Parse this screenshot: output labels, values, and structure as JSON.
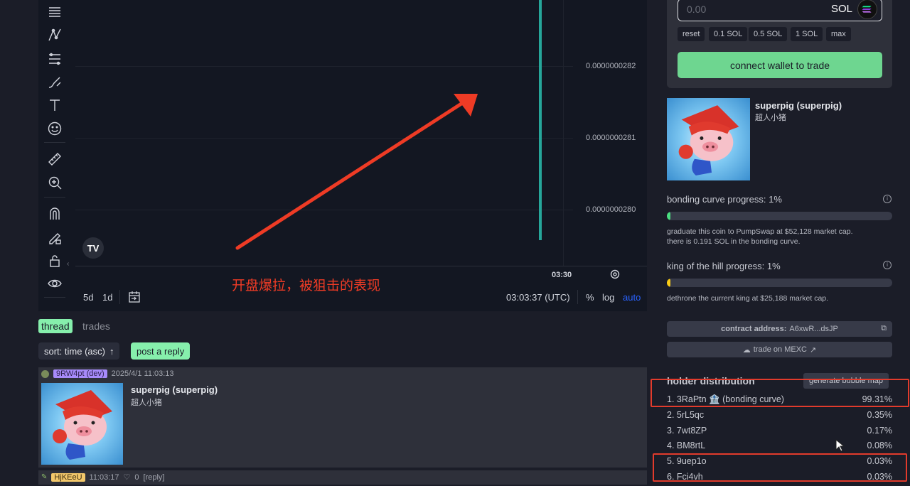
{
  "toolbar": {
    "tools": [
      "menu-lines-icon",
      "trend-line-icon",
      "fib-icon",
      "brush-icon",
      "text-icon",
      "emoji-icon",
      "ruler-icon",
      "zoom-in-icon",
      "magnet-icon",
      "lock-pencil-icon",
      "unlock-icon",
      "eye-icon"
    ]
  },
  "chart": {
    "price_labels": [
      "0.0000000282",
      "0.0000000281",
      "0.0000000280"
    ],
    "time_label": "03:30",
    "annotation": "开盘爆拉，被狙击的表现",
    "logo": "TV",
    "bottom": {
      "range_5d": "5d",
      "range_1d": "1d",
      "clock": "03:03:37 (UTC)",
      "percent": "%",
      "log": "log",
      "auto": "auto"
    }
  },
  "tabs": {
    "thread": "thread",
    "trades": "trades"
  },
  "thread_controls": {
    "sort": "sort: time (asc)",
    "sort_arrow": "↑",
    "reply": "post a reply"
  },
  "posts": [
    {
      "user": "9RW4pt (dev)",
      "time": "2025/4/1 11:03:13",
      "title": "superpig (superpig)",
      "subtitle": "超人小猪"
    },
    {
      "user": "HjKEeU",
      "time": "11:03:17",
      "likes": "0",
      "reply": "[reply]"
    }
  ],
  "trade": {
    "amount_placeholder": "0.00",
    "unit": "SOL",
    "quick_buttons": [
      "reset",
      "0.1 SOL",
      "0.5 SOL",
      "1 SOL",
      "max"
    ],
    "connect": "connect wallet to trade"
  },
  "coin": {
    "name": "superpig (superpig)",
    "subtitle": "超人小猪"
  },
  "bonding": {
    "label": "bonding curve progress: 1%",
    "progress": 0.01,
    "color": "#4ade80",
    "line1": "graduate this coin to PumpSwap at $52,128 market cap.",
    "line2": "there is 0.191 SOL in the bonding curve."
  },
  "king": {
    "label": "king of the hill progress: 1%",
    "progress": 0.01,
    "color": "#facc15",
    "line1": "dethrone the current king at $25,188 market cap."
  },
  "contract": {
    "label": "contract address:",
    "value": "A6xwR...dsJP"
  },
  "mexc": "trade on MEXC",
  "holders": {
    "title": "holder distribution",
    "bubble": "generate bubble map",
    "rows": [
      {
        "name": "1. 3RaPtn 🏦 (bonding curve)",
        "pct": "99.31%"
      },
      {
        "name": "2. 5rL5qc",
        "pct": "0.35%"
      },
      {
        "name": "3. 7wt8ZP",
        "pct": "0.17%"
      },
      {
        "name": "4. BM8rtL",
        "pct": "0.08%"
      },
      {
        "name": "5. 9uep1o",
        "pct": "0.03%"
      },
      {
        "name": "6. Fci4vh",
        "pct": "0.03%"
      }
    ]
  }
}
